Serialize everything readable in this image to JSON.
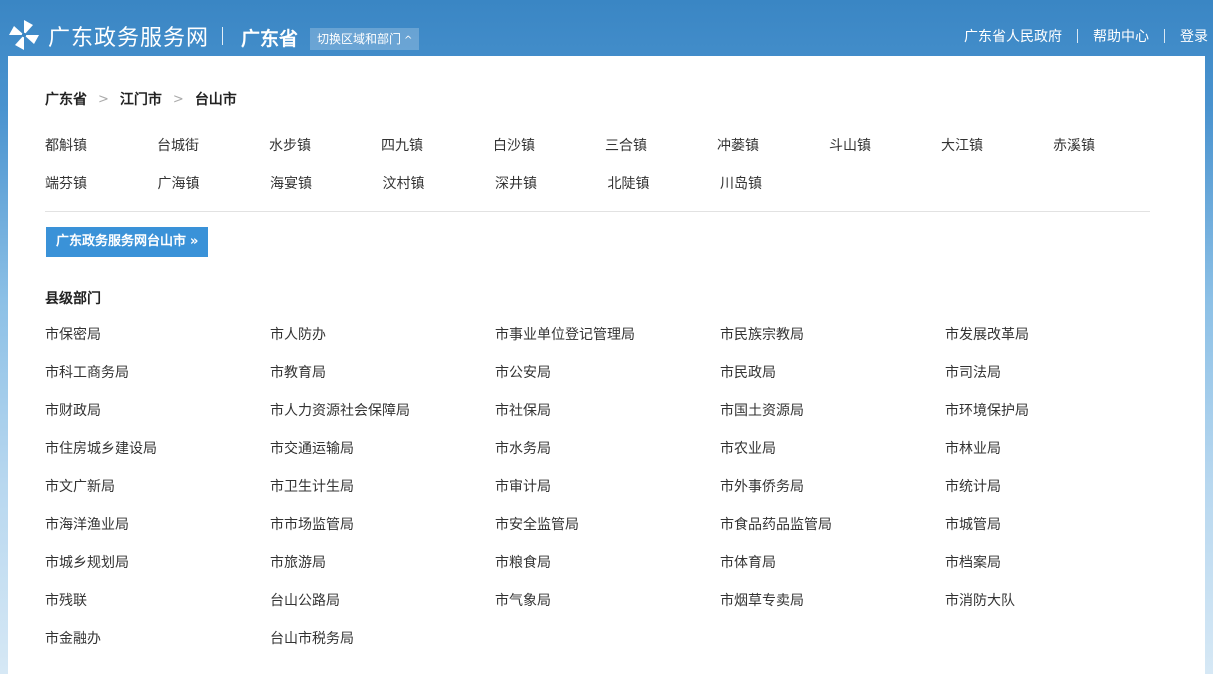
{
  "header": {
    "site_title": "广东政务服务网",
    "province": "广东省",
    "switch_label": "切换区域和部门",
    "links": [
      "广东省人民政府",
      "帮助中心",
      "登录"
    ]
  },
  "breadcrumb": [
    "广东省",
    "江门市",
    "台山市"
  ],
  "towns": [
    [
      "都斛镇",
      "台城街",
      "水步镇",
      "四九镇",
      "白沙镇",
      "三合镇",
      "冲蒌镇",
      "斗山镇",
      "大江镇",
      "赤溪镇"
    ],
    [
      "端芬镇",
      "广海镇",
      "海宴镇",
      "汶村镇",
      "深井镇",
      "北陡镇",
      "川岛镇"
    ]
  ],
  "portal_button": "广东政务服务网台山市",
  "dept_section_title": "县级部门",
  "departments": [
    [
      "市保密局",
      "市人防办",
      "市事业单位登记管理局",
      "市民族宗教局",
      "市发展改革局"
    ],
    [
      "市科工商务局",
      "市教育局",
      "市公安局",
      "市民政局",
      "市司法局"
    ],
    [
      "市财政局",
      "市人力资源社会保障局",
      "市社保局",
      "市国土资源局",
      "市环境保护局"
    ],
    [
      "市住房城乡建设局",
      "市交通运输局",
      "市水务局",
      "市农业局",
      "市林业局"
    ],
    [
      "市文广新局",
      "市卫生计生局",
      "市审计局",
      "市外事侨务局",
      "市统计局"
    ],
    [
      "市海洋渔业局",
      "市市场监管局",
      "市安全监管局",
      "市食品药品监管局",
      "市城管局"
    ],
    [
      "市城乡规划局",
      "市旅游局",
      "市粮食局",
      "市体育局",
      "市档案局"
    ],
    [
      "市残联",
      "台山公路局",
      "市气象局",
      "市烟草专卖局",
      "市消防大队"
    ],
    [
      "市金融办",
      "台山市税务局"
    ]
  ],
  "icons": {
    "logo": "pinwheel-logo-icon",
    "switch_chevron": "chevron-up-icon",
    "portal_arrows": "double-chevron-right-icon",
    "crumb_separator": "chevron-right-icon"
  },
  "colors": {
    "header_blue": "#3a86c4",
    "button_blue": "#3a92d8"
  }
}
